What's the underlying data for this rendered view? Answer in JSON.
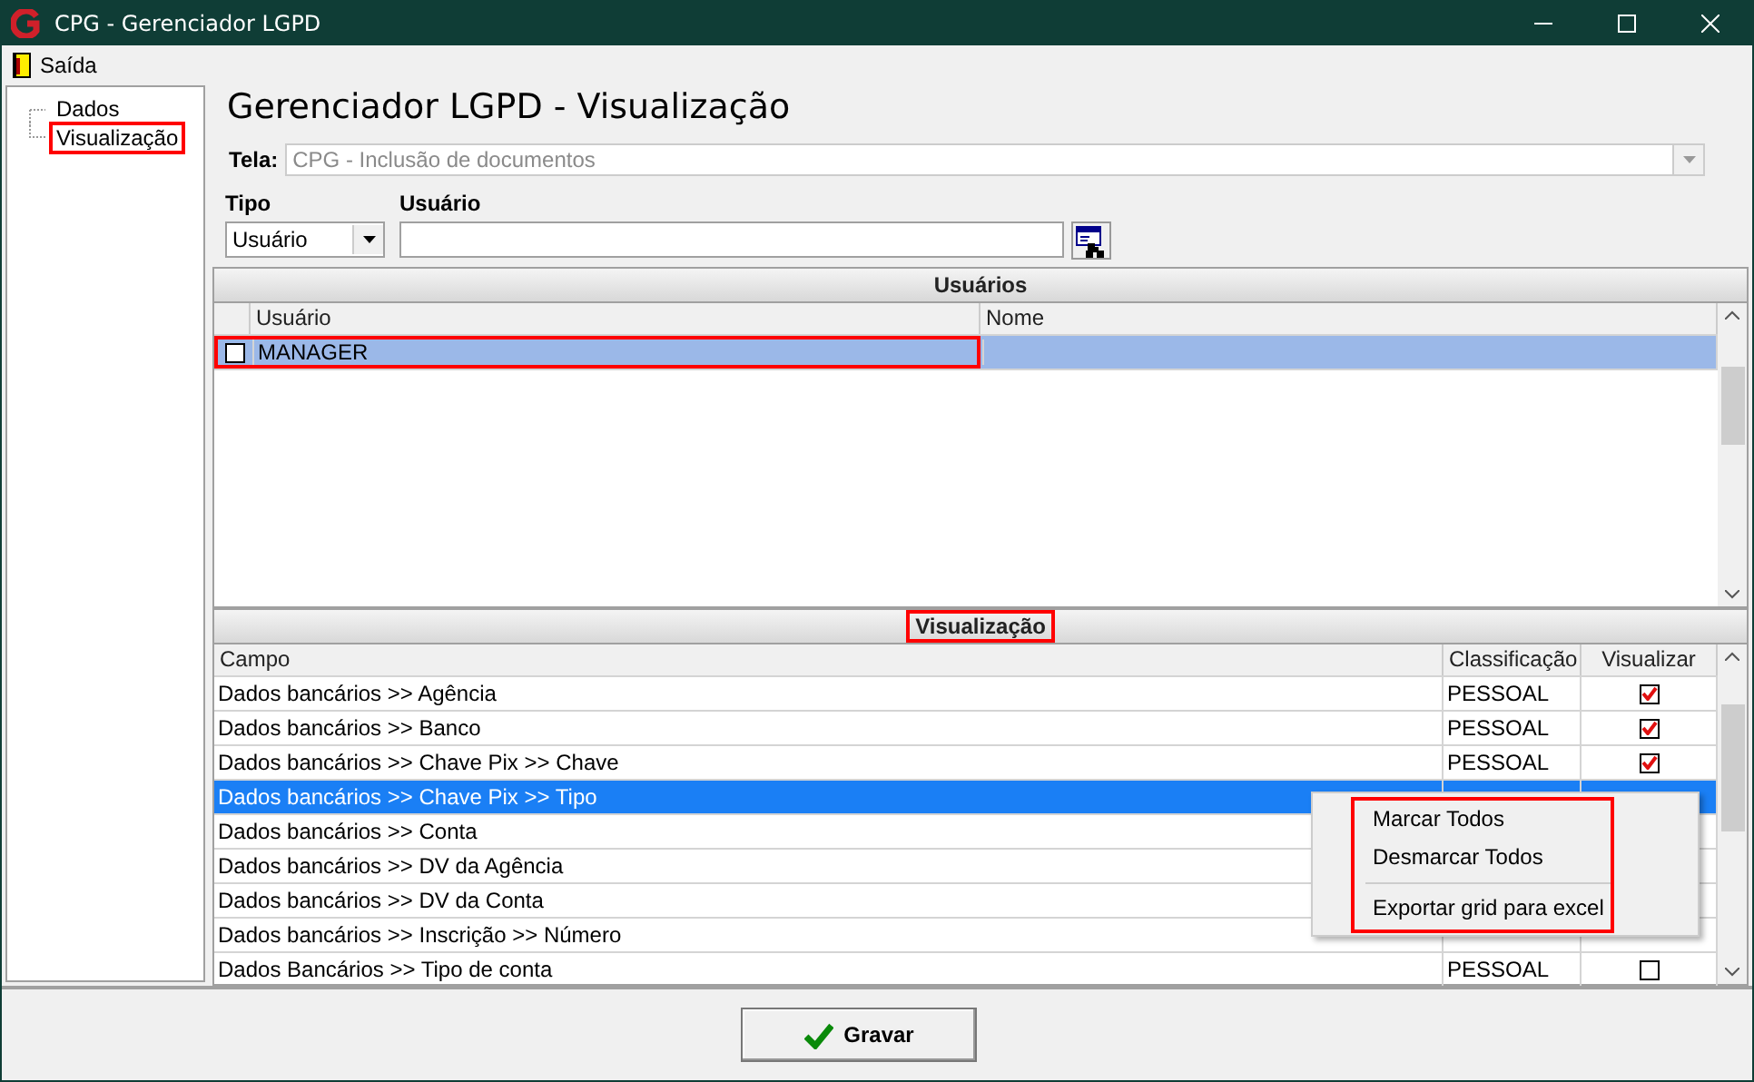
{
  "window": {
    "title": "CPG - Gerenciador LGPD"
  },
  "menu_bar": [
    {
      "label": "Saída"
    }
  ],
  "tree": [
    {
      "label": "Dados",
      "highlighted": false
    },
    {
      "label": "Visualização",
      "highlighted": true
    }
  ],
  "heading": "Gerenciador LGPD - Visualização",
  "tela": {
    "label": "Tela:",
    "value": "CPG - Inclusão de documentos",
    "disabled": true
  },
  "filter": {
    "tipo_label": "Tipo",
    "tipo_value": "Usuário",
    "usuario_label": "Usuário"
  },
  "users_panel": {
    "title": "Usuários",
    "columns": [
      "Usuário",
      "Nome"
    ],
    "rows": [
      {
        "usuario": "MANAGER",
        "nome": "",
        "checked": false,
        "selected": true,
        "highlighted": true
      }
    ]
  },
  "view_panel": {
    "title": "Visualização",
    "title_highlighted": true,
    "columns": [
      "Campo",
      "Classificação",
      "Visualizar"
    ],
    "rows": [
      {
        "campo": "Dados bancários >> Agência",
        "classificacao": "PESSOAL",
        "visualizar": true,
        "selected": false
      },
      {
        "campo": "Dados bancários >> Banco",
        "classificacao": "PESSOAL",
        "visualizar": true,
        "selected": false
      },
      {
        "campo": "Dados bancários >> Chave Pix >> Chave",
        "classificacao": "PESSOAL",
        "visualizar": true,
        "selected": false
      },
      {
        "campo": "Dados bancários >> Chave Pix >> Tipo",
        "selected": true
      },
      {
        "campo": "Dados bancários >> Conta",
        "selected": false
      },
      {
        "campo": "Dados bancários >> DV da Agência",
        "selected": false
      },
      {
        "campo": "Dados bancários >> DV da Conta",
        "selected": false
      },
      {
        "campo": "Dados bancários >> Inscrição >> Número",
        "selected": false
      },
      {
        "campo": "Dados Bancários >> Tipo de conta",
        "classificacao": "PESSOAL",
        "visualizar": false,
        "selected": false
      }
    ]
  },
  "context_menu": {
    "highlighted": true,
    "items": [
      {
        "kind": "item",
        "label": "Marcar Todos"
      },
      {
        "kind": "item",
        "label": "Desmarcar Todos"
      },
      {
        "kind": "separator"
      },
      {
        "kind": "item",
        "label": "Exportar grid para excel"
      }
    ]
  },
  "buttons": [
    {
      "label": "Gravar"
    }
  ]
}
